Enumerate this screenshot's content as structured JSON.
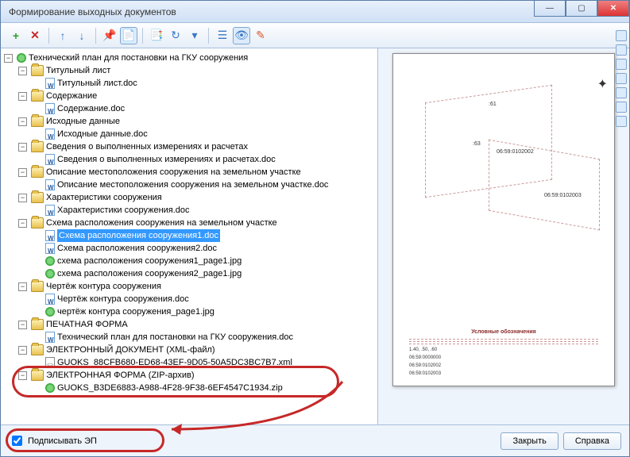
{
  "window": {
    "title": "Формирование выходных документов"
  },
  "toolbar": {
    "add": "+",
    "remove": "✕",
    "up": "↑",
    "down": "↓",
    "pin": "📌",
    "page": "📄",
    "copy": "📑",
    "refresh": "↻",
    "list": "☰",
    "eye": "👁",
    "edit": "✎"
  },
  "tree": {
    "root": "Технический план для постановки на ГКУ сооружения",
    "n1": "Титульный лист",
    "n1f": "Титульный лист.doc",
    "n2": "Содержание",
    "n2f": "Содержание.doc",
    "n3": "Исходные данные",
    "n3f": "Исходные данные.doc",
    "n4": "Сведения о выполненных измерениях и расчетах",
    "n4f": "Сведения о выполненных измерениях и расчетах.doc",
    "n5": "Описание местоположения сооружения на земельном участке",
    "n5f": "Описание местоположения сооружения на земельном участке.doc",
    "n6": "Характеристики сооружения",
    "n6f": "Характеристики сооружения.doc",
    "n7": "Схема расположения сооружения на земельном участке",
    "n7a": "Схема расположения сооружения1.doc",
    "n7b": "Схема расположения сооружения2.doc",
    "n7c": "схема расположения сооружения1_page1.jpg",
    "n7d": "схема расположения сооружения2_page1.jpg",
    "n8": "Чертёж контура сооружения",
    "n8a": "Чертёж контура сооружения.doc",
    "n8b": "чертёж контура сооружения_page1.jpg",
    "n9": "ПЕЧАТНАЯ ФОРМА",
    "n9f": "Технический план для постановки на ГКУ сооружения.doc",
    "n10": "ЭЛЕКТРОННЫЙ ДОКУМЕНТ (XML-файл)",
    "n10f": "GUOKS_88CFB680-ED68-43EF-9D05-50A5DC3BC7B7.xml",
    "n11": "ЭЛЕКТРОННАЯ ФОРМА (ZIP-архив)",
    "n11f": "GUOKS_B3DE6883-A988-4F28-9F38-6EF4547C1934.zip"
  },
  "preview": {
    "parcel1": ":61",
    "parcel2": ":63",
    "cad1": "06:59:0102002",
    "cad2": "06:59:0102003",
    "cad_small1": "06:59:0000000",
    "cad_small2": "06:59:0102002",
    "cad_small3": "06:59:0102003",
    "legend_title": "Условные обозначения",
    "coord_block": "1.40, .50, .60"
  },
  "bottom": {
    "sign_label": "Подписывать ЭП",
    "close": "Закрыть",
    "help": "Справка"
  }
}
